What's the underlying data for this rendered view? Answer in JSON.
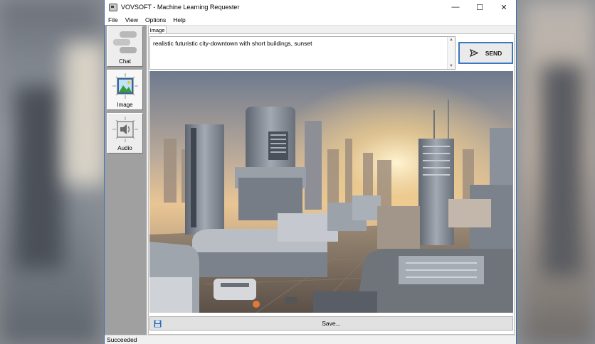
{
  "window": {
    "title": "VOVSOFT - Machine Learning Requester"
  },
  "menu": [
    "File",
    "View",
    "Options",
    "Help"
  ],
  "sidebar": {
    "items": [
      {
        "label": "Chat"
      },
      {
        "label": "Image"
      },
      {
        "label": "Audio"
      }
    ]
  },
  "tab": {
    "label": "Image"
  },
  "prompt": {
    "value": "realistic futuristic city-downtown with short buildings, sunset"
  },
  "send": {
    "label": "SEND"
  },
  "save": {
    "label": "Save..."
  },
  "status": {
    "text": "Succeeded"
  },
  "colors": {
    "accent": "#3b78c2",
    "sidebar": "#a0a0a0",
    "window": "#f0f0f0"
  },
  "icons": [
    "chat-bubbles-icon",
    "image-icon",
    "speaker-icon",
    "send-arrow-icon",
    "floppy-disk-icon",
    "minimize-icon",
    "maximize-icon",
    "close-icon"
  ]
}
